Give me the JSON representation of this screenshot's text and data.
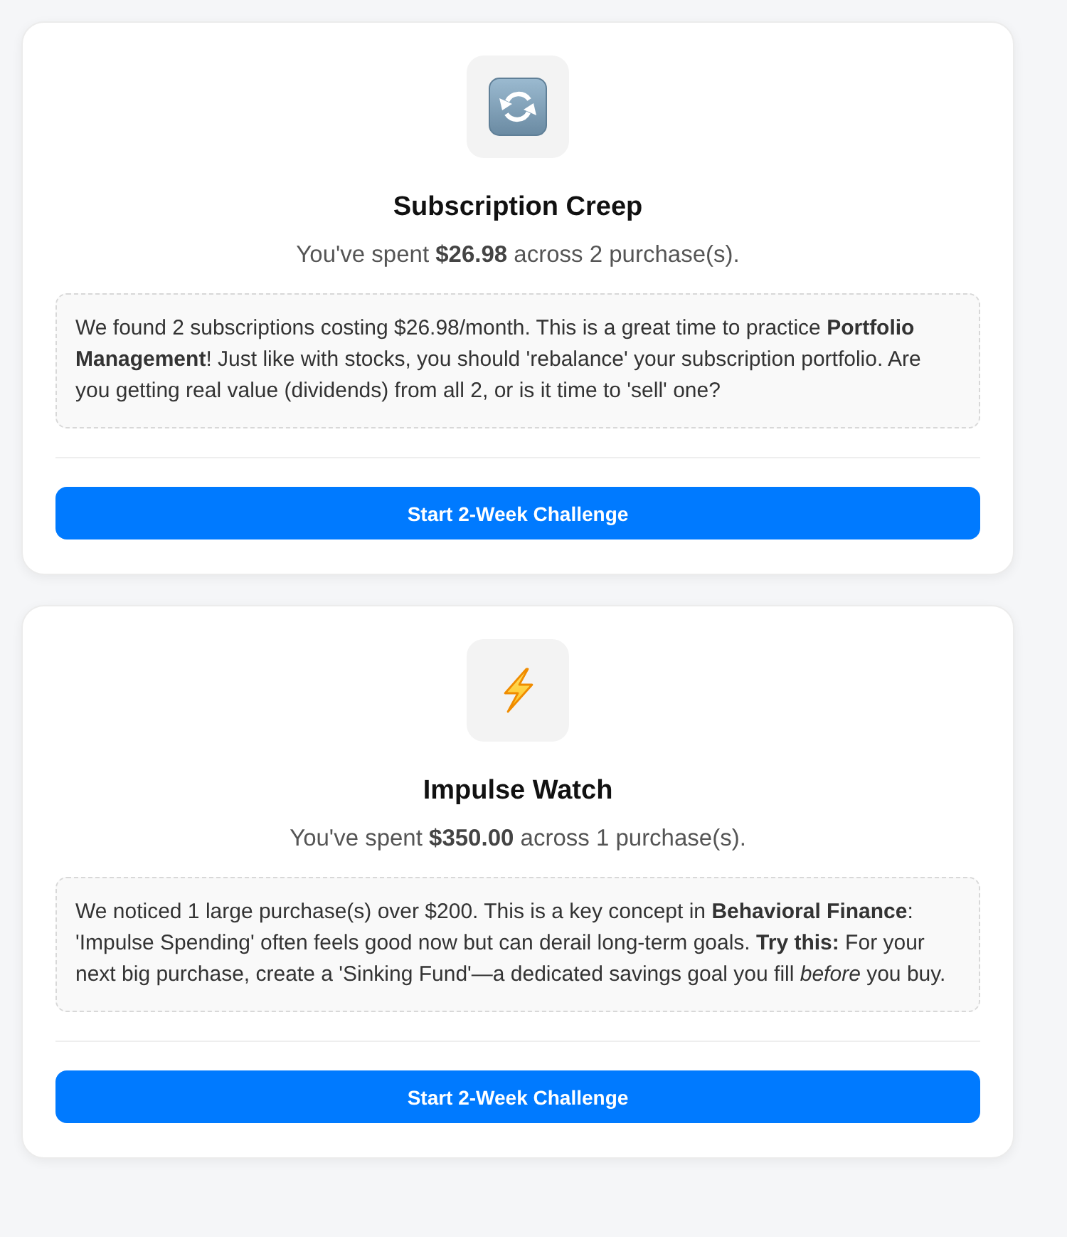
{
  "cards": [
    {
      "kind": "subscription",
      "title": "Subscription Creep",
      "summary": "You've spent **$26.98** across 2 purchase(s).",
      "insight": "We found 2 subscriptions costing $26.98/month. This is a great time to practice **Portfolio Management**! Just like with stocks, you should 'rebalance' your subscription portfolio. Are you getting real value (dividends) from all 2, or is it time to 'sell' one?",
      "button": "Start 2-Week Challenge"
    },
    {
      "kind": "impulse",
      "title": "Impulse Watch",
      "summary": "You've spent **$350.00** across 1 purchase(s).",
      "insight": "We noticed 1 large purchase(s) over $200. This is a key concept in **Behavioral Finance**: 'Impulse Spending' often feels good now but can derail long-term goals. **Try this:** For your next big purchase, create a 'Sinking Fund'—a dedicated savings goal you fill *before* you buy.",
      "button": "Start 2-Week Challenge"
    }
  ]
}
